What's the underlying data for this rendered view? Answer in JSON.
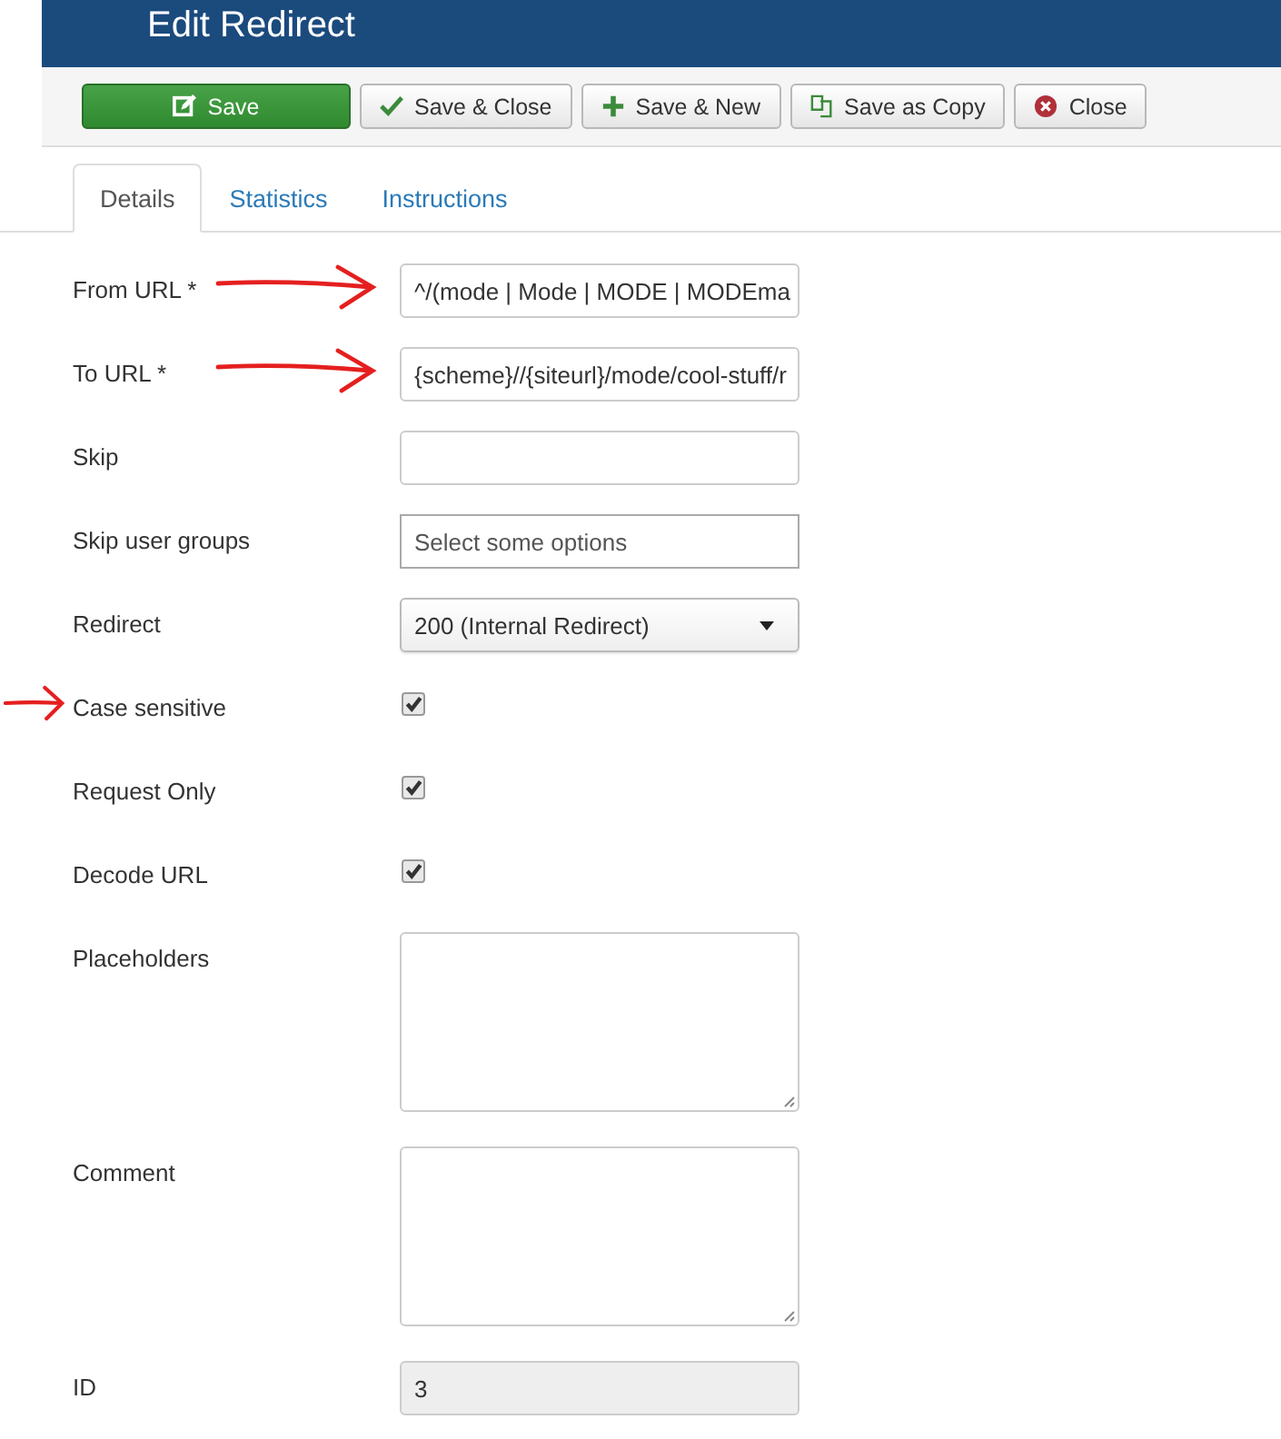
{
  "header": {
    "title": "Edit Redirect"
  },
  "toolbar": [
    {
      "label": "Save",
      "kind": "primary"
    },
    {
      "label": "Save & Close",
      "kind": "default"
    },
    {
      "label": "Save & New",
      "kind": "default"
    },
    {
      "label": "Save as Copy",
      "kind": "default"
    },
    {
      "label": "Close",
      "kind": "default"
    }
  ],
  "tabs": [
    {
      "label": "Details",
      "selected": true
    },
    {
      "label": "Statistics",
      "selected": false
    },
    {
      "label": "Instructions",
      "selected": false
    }
  ],
  "fields": [
    {
      "label": "From URL *",
      "kind": "text",
      "value": "^/(mode | Mode | MODE | MODEma",
      "annotated": true
    },
    {
      "label": "To URL *",
      "kind": "text",
      "value": "{scheme}//{siteurl}/mode/cool-stuff/r",
      "annotated": true
    },
    {
      "label": "Skip",
      "kind": "text"
    },
    {
      "label": "Skip user groups",
      "kind": "multiselect",
      "placeholder": "Select some options"
    },
    {
      "label": "Redirect",
      "kind": "select",
      "value": "200 (Internal Redirect)"
    },
    {
      "label": "Case sensitive",
      "kind": "checkbox",
      "checked": true,
      "annotated": true
    },
    {
      "label": "Request Only",
      "kind": "checkbox",
      "checked": true
    },
    {
      "label": "Decode URL",
      "kind": "checkbox",
      "checked": true
    },
    {
      "label": "Placeholders",
      "kind": "textarea"
    },
    {
      "label": "Comment",
      "kind": "textarea"
    },
    {
      "label": "ID",
      "kind": "readonly",
      "value": "3"
    }
  ]
}
